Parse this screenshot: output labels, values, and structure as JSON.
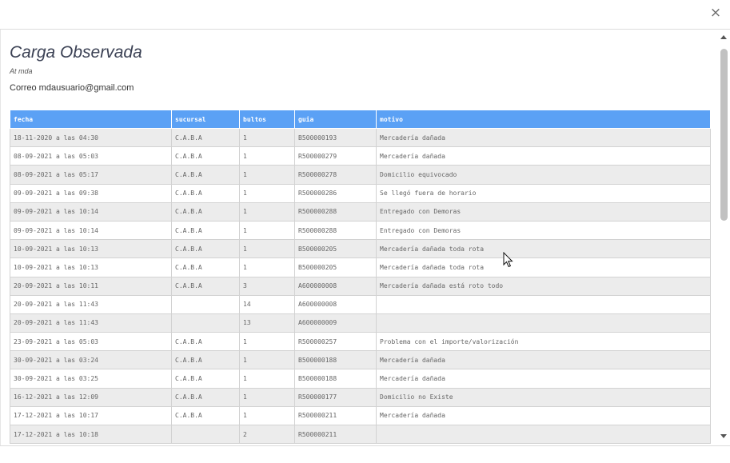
{
  "dialog": {
    "close_glyph": "×",
    "title": "Carga Observada",
    "subtitle": "At mda",
    "email": "Correo mdausuario@gmail.com"
  },
  "table": {
    "header_color": "#5ba1f5",
    "columns": [
      "fecha",
      "sucursal",
      "bultos",
      "guia",
      "motivo"
    ],
    "rows": [
      [
        "18-11-2020 a las 04:30",
        "C.A.B.A",
        "1",
        "B500000193",
        "Mercadería dañada"
      ],
      [
        "08-09-2021 a las 05:03",
        "C.A.B.A",
        "1",
        "R500000279",
        "Mercadería dañada"
      ],
      [
        "08-09-2021 a las 05:17",
        "C.A.B.A",
        "1",
        "R500000278",
        "Domicilio equivocado"
      ],
      [
        "09-09-2021 a las 09:38",
        "C.A.B.A",
        "1",
        "R500000286",
        "Se llegó fuera de horario"
      ],
      [
        "09-09-2021 a las 10:14",
        "C.A.B.A",
        "1",
        "R500000288",
        "Entregado con Demoras"
      ],
      [
        "09-09-2021 a las 10:14",
        "C.A.B.A",
        "1",
        "R500000288",
        "Entregado con Demoras"
      ],
      [
        "10-09-2021 a las 10:13",
        "C.A.B.A",
        "1",
        "B500000205",
        "Mercadería dañada toda rota"
      ],
      [
        "10-09-2021 a las 10:13",
        "C.A.B.A",
        "1",
        "B500000205",
        "Mercadería dañada toda rota"
      ],
      [
        "20-09-2021 a las 10:11",
        "C.A.B.A",
        "3",
        "A600000008",
        "Mercadería dañada está roto todo"
      ],
      [
        "20-09-2021 a las 11:43",
        "",
        "14",
        "A600000008",
        ""
      ],
      [
        "20-09-2021 a las 11:43",
        "",
        "13",
        "A600000009",
        ""
      ],
      [
        "23-09-2021 a las 05:03",
        "C.A.B.A",
        "1",
        "R500000257",
        "Problema con el importe/valorización"
      ],
      [
        "30-09-2021 a las 03:24",
        "C.A.B.A",
        "1",
        "B500000188",
        "Mercadería dañada"
      ],
      [
        "30-09-2021 a las 03:25",
        "C.A.B.A",
        "1",
        "B500000188",
        "Mercadería dañada"
      ],
      [
        "16-12-2021 a las 12:09",
        "C.A.B.A",
        "1",
        "R500000177",
        "Domicilio no Existe"
      ],
      [
        "17-12-2021 a las 10:17",
        "C.A.B.A",
        "1",
        "R500000211",
        "Mercadería dañada"
      ],
      [
        "17-12-2021 a las 10:18",
        "",
        "2",
        "R500000211",
        ""
      ]
    ]
  },
  "icons": {
    "close": "close-icon",
    "scroll_up": "chevron-up-icon",
    "scroll_down": "chevron-down-icon",
    "cursor": "mouse-pointer-icon"
  }
}
